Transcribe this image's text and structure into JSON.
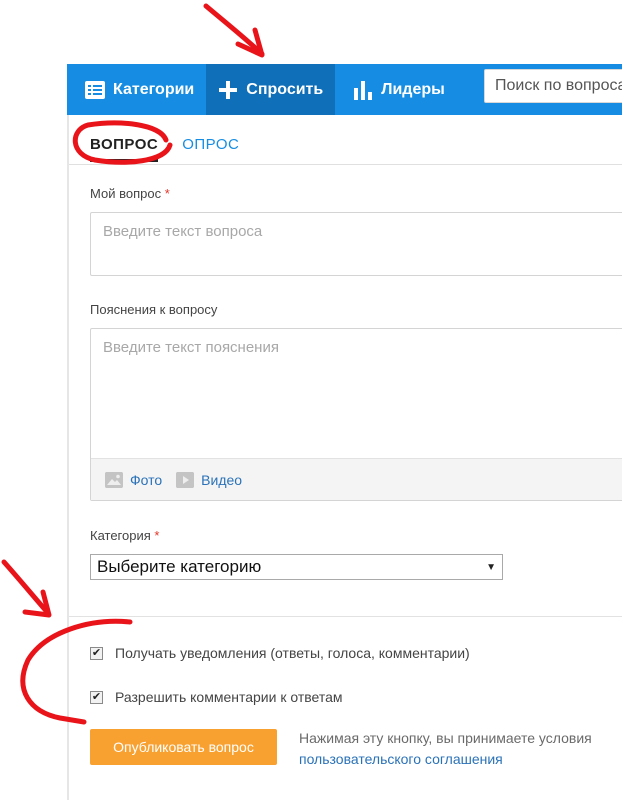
{
  "nav": {
    "categories_label": "Категории",
    "ask_label": "Спросить",
    "leaders_label": "Лидеры",
    "search_placeholder": "Поиск по вопросам"
  },
  "tabs": {
    "question_label": "ВОПРОС",
    "poll_label": "ОПРОС"
  },
  "form": {
    "question_label": "Мой вопрос",
    "required_mark": "*",
    "question_placeholder": "Введите текст вопроса",
    "details_label": "Пояснения к вопросу",
    "details_placeholder": "Введите текст пояснения",
    "photo_label": "Фото",
    "video_label": "Видео",
    "category_label": "Категория",
    "category_selected": "Выберите категорию",
    "notify_label": "Получать уведомления (ответы, голоса, комментарии)",
    "allow_comments_label": "Разрешить комментарии к ответам",
    "publish_label": "Опубликовать вопрос",
    "agreement_text": "Нажимая эту кнопку, вы принимаете условия",
    "agreement_link": "пользовательского соглашения"
  },
  "colors": {
    "nav_bg": "#168de2",
    "nav_active": "#0f6fb9",
    "link": "#2a72b8",
    "publish_btn": "#f9a130",
    "annotation": "#e8141a"
  }
}
